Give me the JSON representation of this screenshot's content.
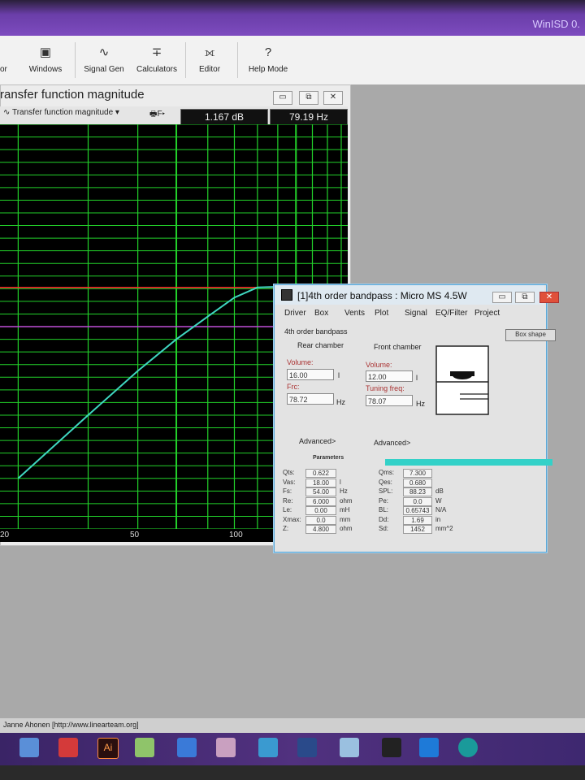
{
  "app": {
    "title": "WinISD 0."
  },
  "toolbar": {
    "items": [
      {
        "label": "Windows",
        "icon": "windows-icon",
        "glyph": "▣"
      },
      {
        "label": "Signal Gen",
        "icon": "signal-gen-icon",
        "glyph": "∿"
      },
      {
        "label": "Calculators",
        "icon": "calculator-icon",
        "glyph": "∓"
      },
      {
        "label": "Editor",
        "icon": "editor-icon",
        "glyph": "⟗"
      },
      {
        "label": "Help Mode",
        "icon": "help-icon",
        "glyph": "?"
      }
    ],
    "cut_label": "or"
  },
  "tf_window": {
    "title": "ransfer function magnitude",
    "dropdown_label": "Transfer function magnitude",
    "readout_db": "1.167 dB",
    "readout_hz": "79.19 Hz",
    "f_button": "F",
    "x_ticks": [
      "20",
      "50",
      "100"
    ]
  },
  "chart_data": {
    "type": "line",
    "title": "",
    "xlabel": "",
    "ylabel": "",
    "x_scale": "log",
    "grid": true,
    "series": [
      {
        "x": [
          20,
          30,
          40,
          50,
          60,
          70,
          80,
          100,
          115,
          130
        ],
        "y": [
          -14,
          -9,
          -5.5,
          -3,
          -1.2,
          0.3,
          1.1,
          1.2,
          0.5,
          -1.5
        ]
      }
    ],
    "reference_lines": [
      {
        "color": "#ff2a2a",
        "y": 1.1
      },
      {
        "color": "#c04fd8",
        "y": -2.0
      }
    ],
    "colors": {
      "curve": "#3fd6c0",
      "grid": "#22d02a",
      "background": "#000000"
    }
  },
  "bp_window": {
    "title": "[1]4th order bandpass : Micro MS 4.5W",
    "tabs": [
      "Driver",
      "Box",
      "Vents",
      "Plot",
      "Signal",
      "EQ/Filter",
      "Project"
    ],
    "box_label": "4th order bandpass",
    "box_shape_button": "Box shape",
    "rear": {
      "header": "Rear chamber",
      "volume_label": "Volume:",
      "volume": "16.00",
      "volume_unit": "l",
      "f_label": "Frc:",
      "f_value": "78.72",
      "f_unit": "Hz",
      "advanced": "Advanced>"
    },
    "front": {
      "header": "Front chamber",
      "volume_label": "Volume:",
      "volume": "12.00",
      "volume_unit": "l",
      "f_label": "Tuning freq:",
      "f_value": "78.07",
      "f_unit": "Hz",
      "advanced": "Advanced>"
    },
    "params_header": "Parameters",
    "params_left": [
      {
        "name": "Qts:",
        "value": "0.622",
        "unit": ""
      },
      {
        "name": "Vas:",
        "value": "18.00",
        "unit": "l"
      },
      {
        "name": "Fs:",
        "value": "54.00",
        "unit": "Hz"
      },
      {
        "name": "Re:",
        "value": "6.000",
        "unit": "ohm"
      },
      {
        "name": "Le:",
        "value": "0.00",
        "unit": "mH"
      },
      {
        "name": "Xmax:",
        "value": "0.0",
        "unit": "mm"
      },
      {
        "name": "Z:",
        "value": "4.800",
        "unit": "ohm"
      }
    ],
    "params_right": [
      {
        "name": "Qms:",
        "value": "7.300",
        "unit": ""
      },
      {
        "name": "Qes:",
        "value": "0.680",
        "unit": ""
      },
      {
        "name": "SPL:",
        "value": "88.23",
        "unit": "dB"
      },
      {
        "name": "Pe:",
        "value": "0.0",
        "unit": "W"
      },
      {
        "name": "BL:",
        "value": "0.65743",
        "unit": "N/A"
      },
      {
        "name": "Dd:",
        "value": "1.69",
        "unit": "in"
      },
      {
        "name": "Sd:",
        "value": "1452",
        "unit": "mm^2"
      }
    ]
  },
  "status": {
    "text": "Janne Ahonen [http://www.linearteam.org]"
  },
  "taskbar": {
    "ai_label": "Ai"
  }
}
